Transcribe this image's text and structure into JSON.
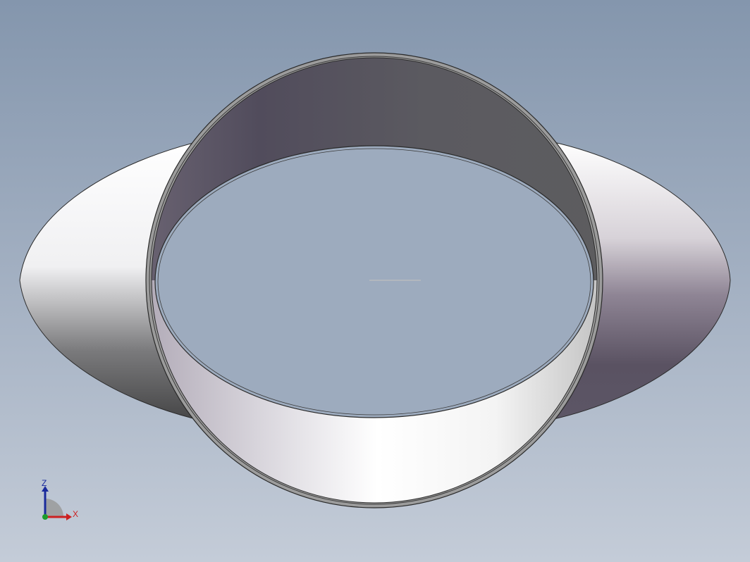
{
  "viewport": {
    "background_top": "#8496ad",
    "background_bottom": "#c4ccd8"
  },
  "model": {
    "type": "3d-ring-with-elliptical-flange",
    "edge_color": "#2a2a2a",
    "flange_colors": [
      "#ffffff",
      "#4b4b4b",
      "#504a5c",
      "#8a8090"
    ],
    "ring_colors": [
      "#555260",
      "#5c5868",
      "#ffffff",
      "#8e8a92"
    ]
  },
  "triad": {
    "z_label": "Z",
    "x_label": "X",
    "z_color": "#1a2a9c",
    "x_color": "#cc2020",
    "y_color": "#1c9c2c"
  }
}
